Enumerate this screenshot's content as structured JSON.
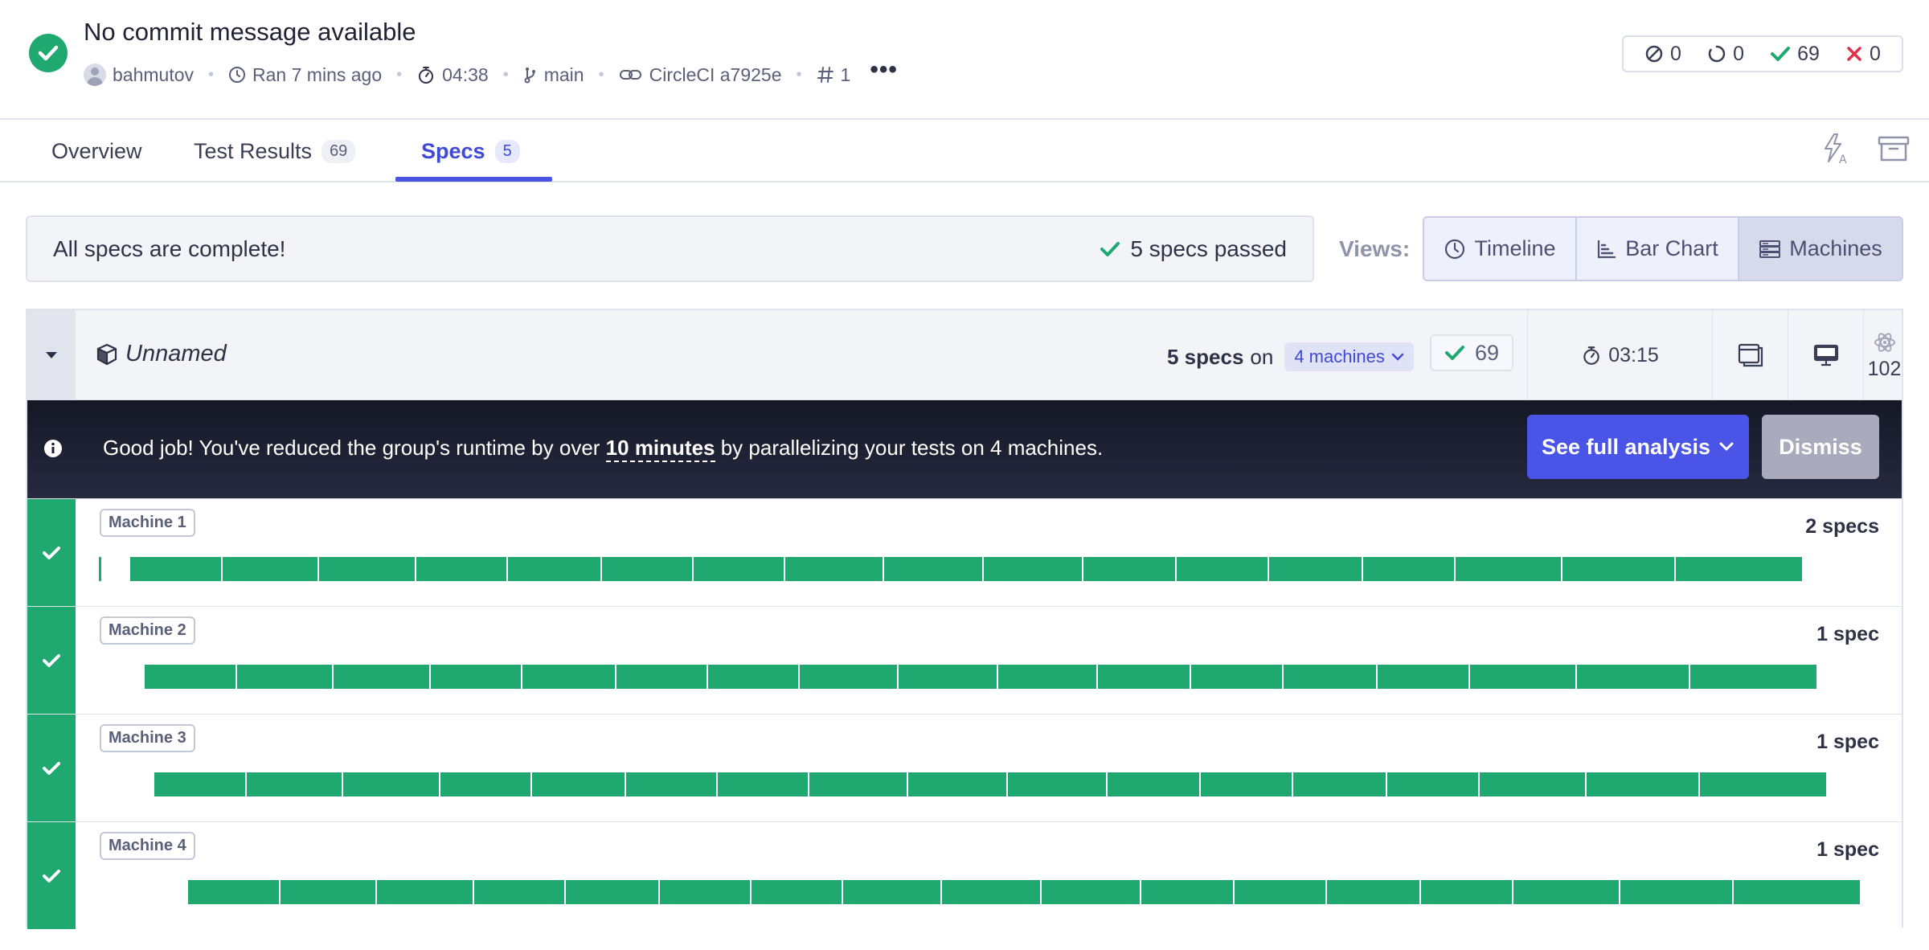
{
  "header": {
    "title": "No commit message available",
    "author": "bahmutov",
    "ran": "Ran 7 mins ago",
    "duration": "04:38",
    "branch": "main",
    "ci": "CircleCI a7925e",
    "run_number": "1",
    "more": "•••"
  },
  "counts": {
    "skipped": "0",
    "pending": "0",
    "passed": "69",
    "failed": "0"
  },
  "tabs": [
    {
      "label": "Overview"
    },
    {
      "label": "Test Results",
      "badge": "69"
    },
    {
      "label": "Specs",
      "badge": "5"
    }
  ],
  "summary": {
    "message": "All specs are complete!",
    "passed": "5 specs passed"
  },
  "views": {
    "label": "Views:",
    "options": [
      "Timeline",
      "Bar Chart",
      "Machines"
    ],
    "selected": "Machines"
  },
  "group": {
    "name": "Unnamed",
    "specs_count": "5 specs",
    "on": "on",
    "machines": "4 machines",
    "passed": "69",
    "duration": "03:15",
    "browser_version": "102"
  },
  "banner": {
    "text_before": "Good job! You've reduced the group's runtime by over ",
    "highlight": "10 minutes",
    "text_after": " by parallelizing your tests on 4 machines.",
    "analysis_button": "See full analysis",
    "dismiss_button": "Dismiss"
  },
  "machines": [
    {
      "label": "Machine 1",
      "specs": "2 specs"
    },
    {
      "label": "Machine 2",
      "specs": "1 spec"
    },
    {
      "label": "Machine 3",
      "specs": "1 spec"
    },
    {
      "label": "Machine 4",
      "specs": "1 spec"
    }
  ],
  "colors": {
    "pass": "#1fa971",
    "accent": "#4953e3",
    "banner": "#1b1e2e",
    "fail": "#e0314b"
  }
}
